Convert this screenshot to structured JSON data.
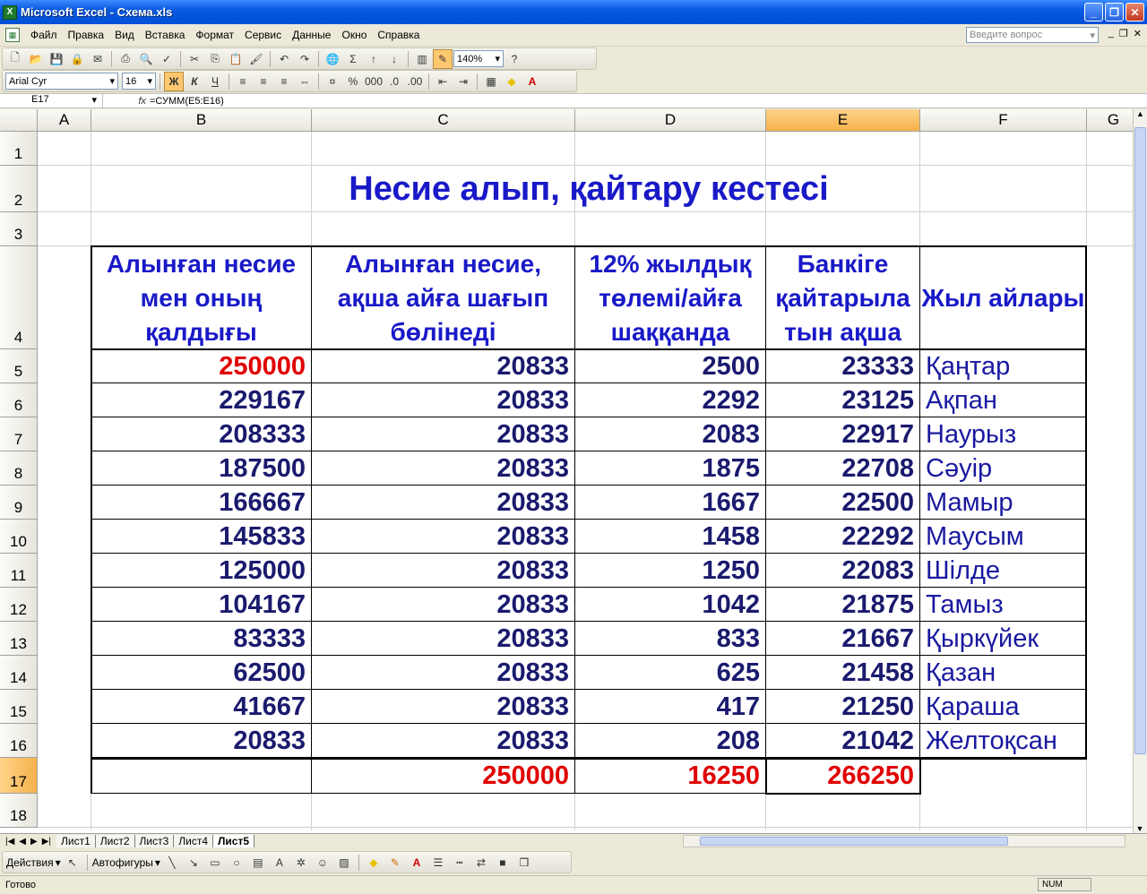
{
  "window": {
    "title": "Microsoft Excel - Схема.xls",
    "app_icon": "X"
  },
  "menu": [
    "Файл",
    "Правка",
    "Вид",
    "Вставка",
    "Формат",
    "Сервис",
    "Данные",
    "Окно",
    "Справка"
  ],
  "help_placeholder": "Введите вопрос",
  "toolbar": {
    "zoom": "140%",
    "font": "Arial Cyr",
    "size": "16",
    "bold": "Ж",
    "italic": "К",
    "underline": "Ч"
  },
  "formula_bar": {
    "cell_ref": "E17",
    "fx": "fx",
    "formula": "=СУММ(E5:E16)"
  },
  "columns": [
    "A",
    "B",
    "C",
    "D",
    "E",
    "F",
    "G"
  ],
  "rows": [
    "1",
    "2",
    "3",
    "4",
    "5",
    "6",
    "7",
    "8",
    "9",
    "10",
    "11",
    "12",
    "13",
    "14",
    "15",
    "16",
    "17",
    "18"
  ],
  "sheet": {
    "title": "Несие алып, қайтару кестесі",
    "headers": [
      "Алынған несие мен оның қалдығы",
      "Алынған несие, ақша айға шағып бөлінеді",
      "12% жылдық төлемі/айға шаққанда",
      "Банкіге қайтарыла тын ақша",
      "Жыл айлары"
    ],
    "data": [
      [
        "250000",
        "20833",
        "2500",
        "23333",
        "Қаңтар"
      ],
      [
        "229167",
        "20833",
        "2292",
        "23125",
        "Ақпан"
      ],
      [
        "208333",
        "20833",
        "2083",
        "22917",
        "Наурыз"
      ],
      [
        "187500",
        "20833",
        "1875",
        "22708",
        "Сәуір"
      ],
      [
        "166667",
        "20833",
        "1667",
        "22500",
        "Мамыр"
      ],
      [
        "145833",
        "20833",
        "1458",
        "22292",
        "Маусым"
      ],
      [
        "125000",
        "20833",
        "1250",
        "22083",
        "Шілде"
      ],
      [
        "104167",
        "20833",
        "1042",
        "21875",
        "Тамыз"
      ],
      [
        "83333",
        "20833",
        "833",
        "21667",
        "Қыркүйек"
      ],
      [
        "62500",
        "20833",
        "625",
        "21458",
        "Қазан"
      ],
      [
        "41667",
        "20833",
        "417",
        "21250",
        "Қараша"
      ],
      [
        "20833",
        "20833",
        "208",
        "21042",
        "Желтоқсан"
      ]
    ],
    "totals": [
      "250000",
      "16250",
      "266250"
    ]
  },
  "sheet_tabs": [
    "Лист1",
    "Лист2",
    "Лист3",
    "Лист4",
    "Лист5"
  ],
  "active_tab": "Лист5",
  "drawing": {
    "actions": "Действия",
    "autoshapes": "Автофигуры"
  },
  "status": {
    "ready": "Готово",
    "num": "NUM"
  }
}
